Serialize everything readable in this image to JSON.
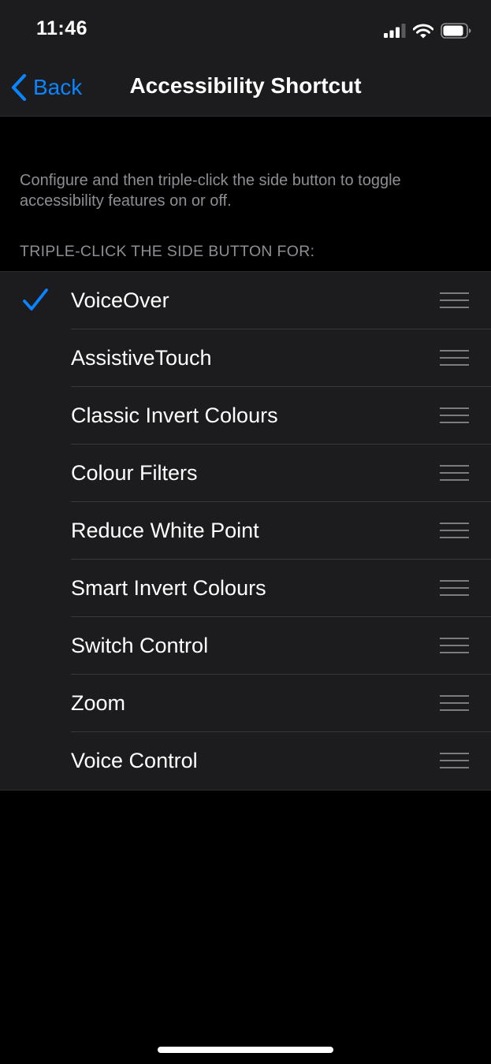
{
  "status_bar": {
    "time": "11:46"
  },
  "nav": {
    "back_label": "Back",
    "title": "Accessibility Shortcut"
  },
  "description": "Configure and then triple-click the side button to toggle accessibility features on or off.",
  "section_header": "TRIPLE-CLICK THE SIDE BUTTON FOR:",
  "items": [
    {
      "label": "VoiceOver",
      "checked": true
    },
    {
      "label": "AssistiveTouch",
      "checked": false
    },
    {
      "label": "Classic Invert Colours",
      "checked": false
    },
    {
      "label": "Colour Filters",
      "checked": false
    },
    {
      "label": "Reduce White Point",
      "checked": false
    },
    {
      "label": "Smart Invert Colours",
      "checked": false
    },
    {
      "label": "Switch Control",
      "checked": false
    },
    {
      "label": "Zoom",
      "checked": false
    },
    {
      "label": "Voice Control",
      "checked": false
    }
  ],
  "icons": {
    "checkmark": "checkmark-icon",
    "reorder": "reorder-handle-icon",
    "back": "chevron-left-icon",
    "signal": "cellular-signal-icon",
    "wifi": "wifi-icon",
    "battery": "battery-icon"
  },
  "colors": {
    "accent": "#0a84ff",
    "background": "#000000",
    "group_background": "#1c1c1e",
    "secondary_text": "#8d8d93"
  }
}
